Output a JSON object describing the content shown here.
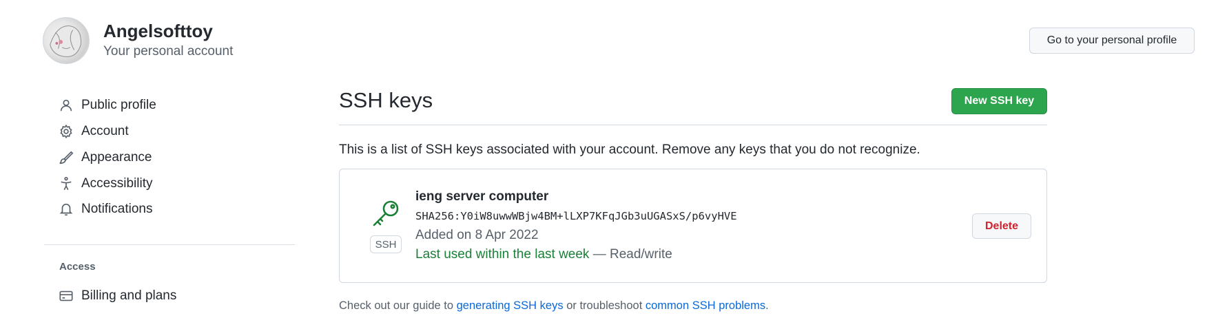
{
  "account": {
    "name": "Angelsofttoy",
    "subtitle": "Your personal account",
    "profile_button": "Go to your personal profile",
    "avatar_icon": "avatar-image"
  },
  "sidebar": {
    "items": [
      {
        "label": "Public profile",
        "icon": "person-icon"
      },
      {
        "label": "Account",
        "icon": "gear-icon"
      },
      {
        "label": "Appearance",
        "icon": "paintbrush-icon"
      },
      {
        "label": "Accessibility",
        "icon": "accessibility-icon"
      },
      {
        "label": "Notifications",
        "icon": "bell-icon"
      }
    ],
    "section_label": "Access",
    "access_items": [
      {
        "label": "Billing and plans",
        "icon": "credit-card-icon"
      }
    ]
  },
  "main": {
    "title": "SSH keys",
    "new_key_button": "New SSH key",
    "intro": "This is a list of SSH keys associated with your account. Remove any keys that you do not recognize.",
    "keys": [
      {
        "title": "ieng server computer",
        "fingerprint": "SHA256:Y0iW8uwwWBjw4BM+lLXP7KFqJGb3uUGASxS/p6vyHVE",
        "added": "Added on 8 Apr 2022",
        "last_used": "Last used within the last week",
        "access": " — Read/write",
        "badge": "SSH",
        "icon": "key-icon",
        "delete_label": "Delete"
      }
    ],
    "footer": {
      "prefix": "Check out our guide to ",
      "link1": "generating SSH keys",
      "middle": " or troubleshoot ",
      "link2": "common SSH problems",
      "suffix": "."
    }
  },
  "colors": {
    "accent_green": "#2da44e",
    "text_green": "#1a7f37",
    "danger": "#cf222e",
    "link": "#0969da",
    "muted": "#57606a"
  }
}
